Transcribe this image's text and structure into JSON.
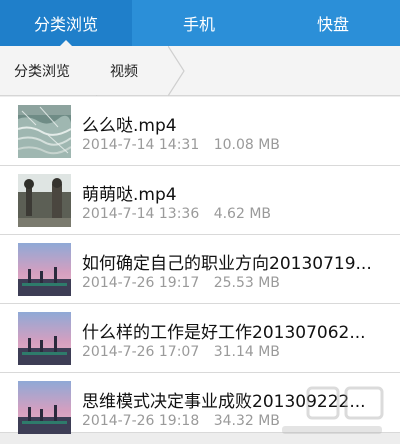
{
  "tabs": [
    {
      "label": "分类浏览"
    },
    {
      "label": "手机"
    },
    {
      "label": "快盘"
    }
  ],
  "breadcrumb": [
    {
      "label": "分类浏览"
    },
    {
      "label": "视频"
    }
  ],
  "files": [
    {
      "name": "么么哒.mp4",
      "date": "2014-7-14 14:31",
      "size": "10.08 MB",
      "thumb": "water"
    },
    {
      "name": "萌萌哒.mp4",
      "date": "2014-7-14 13:36",
      "size": "4.62 MB",
      "thumb": "street"
    },
    {
      "name": "如何确定自己的职业方向20130719...",
      "date": "2014-7-26 19:17",
      "size": "25.53 MB",
      "thumb": "sunset"
    },
    {
      "name": "什么样的工作是好工作201307062...",
      "date": "2014-7-26 17:07",
      "size": "31.14 MB",
      "thumb": "sunset"
    },
    {
      "name": "思维模式决定事业成败201309222...",
      "date": "2014-7-26 19:18",
      "size": "34.32 MB",
      "thumb": "sunset"
    }
  ],
  "colors": {
    "topbar": "#2b8fd8",
    "topbar_active": "#1f7fca",
    "meta_text": "#9a9a9a"
  }
}
